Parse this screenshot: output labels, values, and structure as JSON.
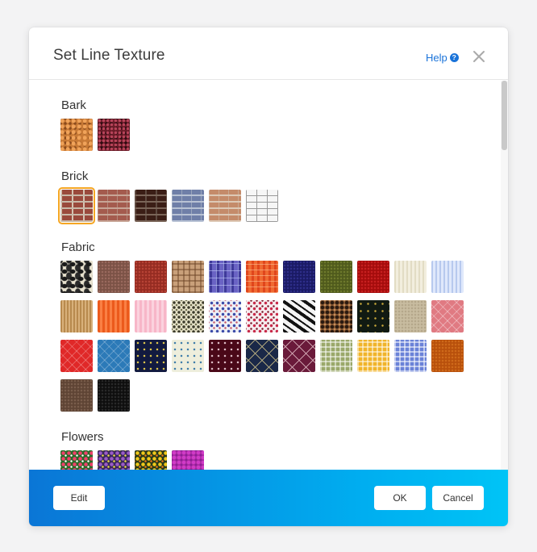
{
  "dialog": {
    "title": "Set Line Texture",
    "help_label": "Help",
    "help_icon": "question-circle-icon",
    "close_icon": "close-icon"
  },
  "sections": [
    {
      "label": "Bark"
    },
    {
      "label": "Brick"
    },
    {
      "label": "Fabric"
    },
    {
      "label": "Flowers"
    }
  ],
  "selected_texture": "brick-1",
  "footer": {
    "edit_label": "Edit",
    "ok_label": "OK",
    "cancel_label": "Cancel"
  },
  "colors": {
    "link": "#1a73d9",
    "selection": "#f5a623",
    "footer_start": "#0a76d6",
    "footer_end": "#00c4f6"
  }
}
